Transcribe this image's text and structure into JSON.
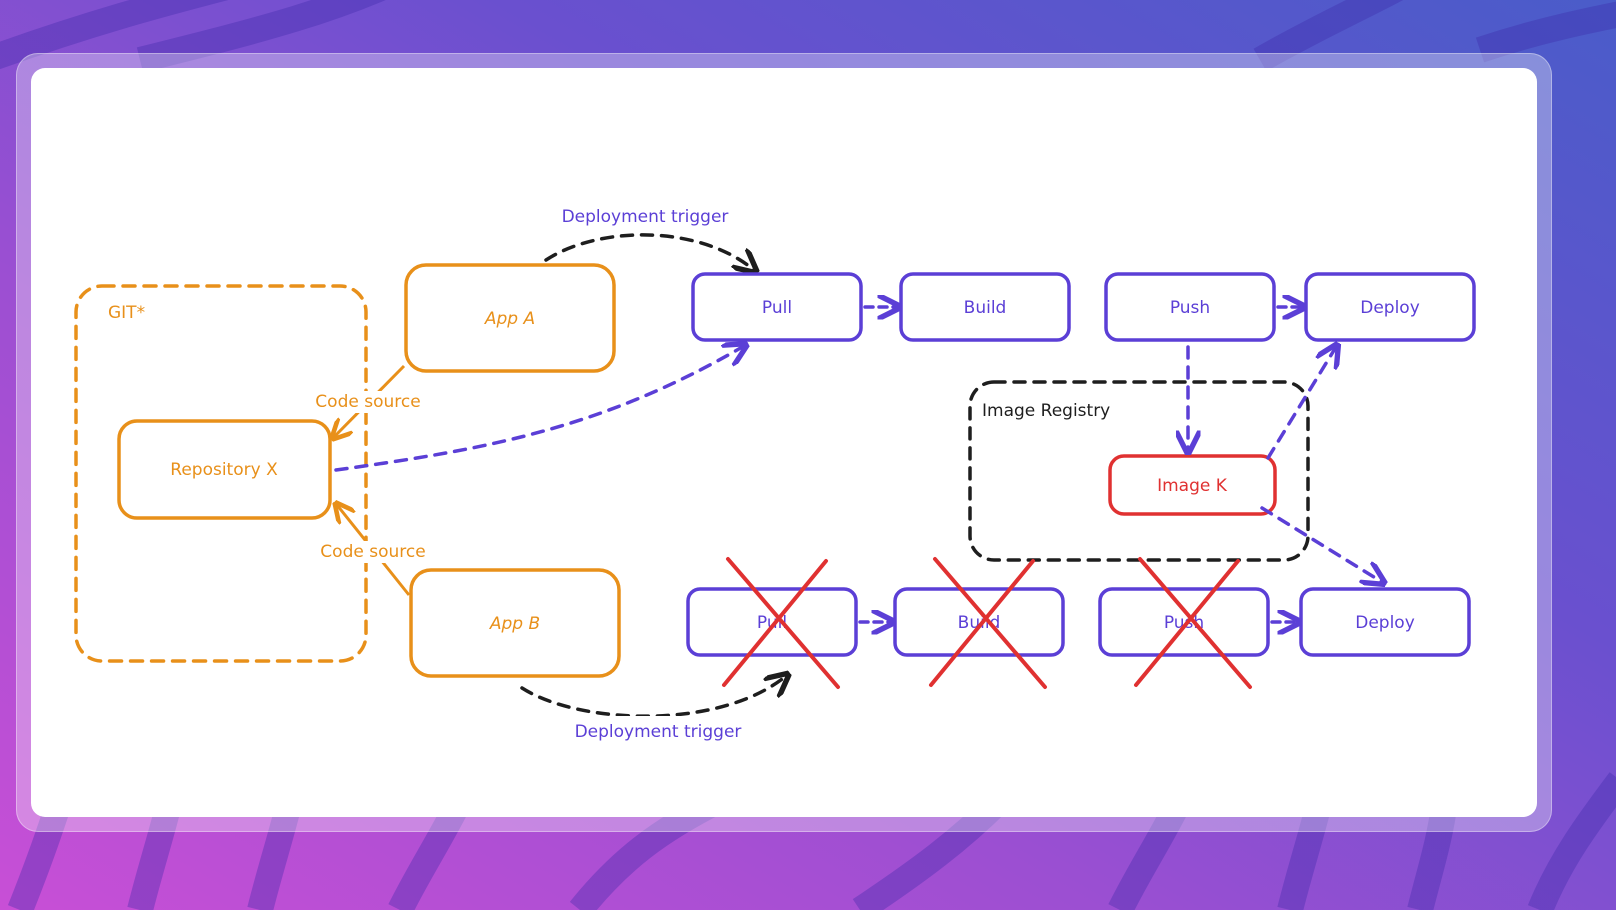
{
  "colors": {
    "git": "#e8901a",
    "pipeline": "#5b3fd6",
    "registry": "#1e1e1e",
    "image": "#e03131",
    "trigger": "#1e1e1e",
    "cross": "#e03131"
  },
  "git_group": {
    "label": "GIT*"
  },
  "repository": {
    "label": "Repository X"
  },
  "apps": [
    {
      "label": "App A"
    },
    {
      "label": "App B"
    }
  ],
  "edge_labels": {
    "code_source_a": "Code source",
    "code_source_b": "Code source",
    "trigger_a": "Deployment trigger",
    "trigger_b": "Deployment trigger"
  },
  "pipeline_top": [
    {
      "label": "Pull",
      "crossed": false
    },
    {
      "label": "Build",
      "crossed": false
    },
    {
      "label": "Push",
      "crossed": false
    },
    {
      "label": "Deploy",
      "crossed": false
    }
  ],
  "pipeline_bottom": [
    {
      "label": "Pull",
      "crossed": true
    },
    {
      "label": "Build",
      "crossed": true
    },
    {
      "label": "Push",
      "crossed": true
    },
    {
      "label": "Deploy",
      "crossed": false
    }
  ],
  "registry": {
    "label": "Image Registry"
  },
  "image": {
    "label": "Image K"
  }
}
